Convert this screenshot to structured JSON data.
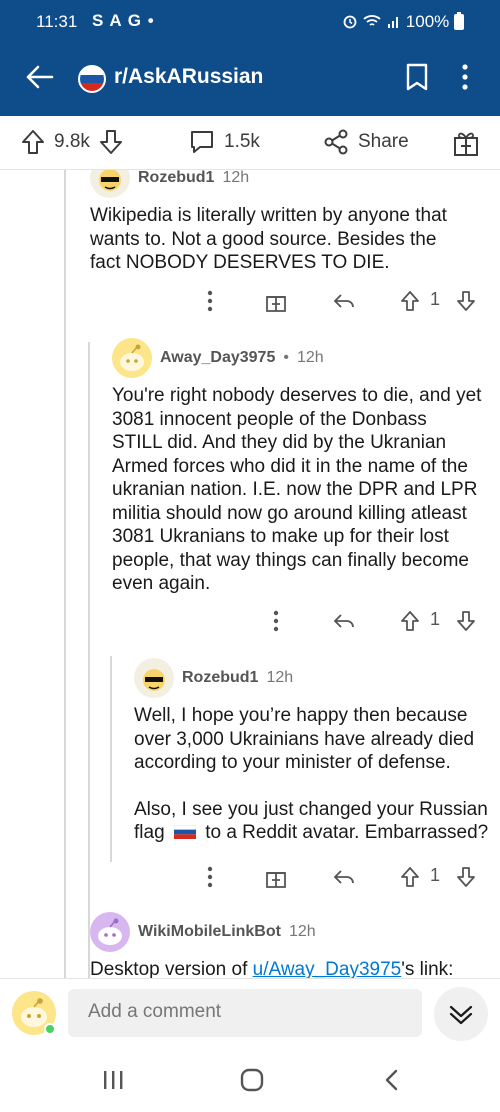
{
  "status_bar": {
    "time": "11:31",
    "notifications": "S A G •",
    "battery": "100%"
  },
  "header": {
    "subreddit": "r/AskARussian"
  },
  "post_actions": {
    "upvotes": "9.8k",
    "comments": "1.5k",
    "share": "Share"
  },
  "comments": [
    {
      "author": "Rozebud1",
      "time": "12h",
      "body": "Wikipedia is literally written by anyone that wants to.  Not a good source.  Besides the fact NOBODY DESERVES TO DIE.",
      "score": "1"
    },
    {
      "author": "Away_Day3975",
      "separator": "•",
      "time": "12h",
      "body": "You're right nobody deserves to die,  and yet 3081 innocent people of the Donbass STILL did. And they did by the Ukranian Armed forces who did it in the name of the ukranian nation. I.E. now the DPR and LPR militia should now go around killing atleast 3081 Ukranians to make up for their lost people, that way things can finally become even again.",
      "score": "1"
    },
    {
      "author": "Rozebud1",
      "time": "12h",
      "body_p1": "Well, I hope you’re happy then because over 3,000 Ukrainians have already died according to your minister of defense.",
      "body_p2_a": "Also, I see you just changed your Russian flag",
      "body_p2_b": "to a Reddit avatar.  Embarrassed?",
      "score": "1"
    },
    {
      "author": "WikiMobileLinkBot",
      "time": "12h",
      "body_prefix": "Desktop version of ",
      "body_link": "u/Away_Day3975",
      "body_suffix": "'s link:"
    }
  ],
  "composer": {
    "placeholder": "Add a comment"
  },
  "colors": {
    "header_bg": "#0f4c8a",
    "link": "#0079d3",
    "online": "#46d160"
  }
}
